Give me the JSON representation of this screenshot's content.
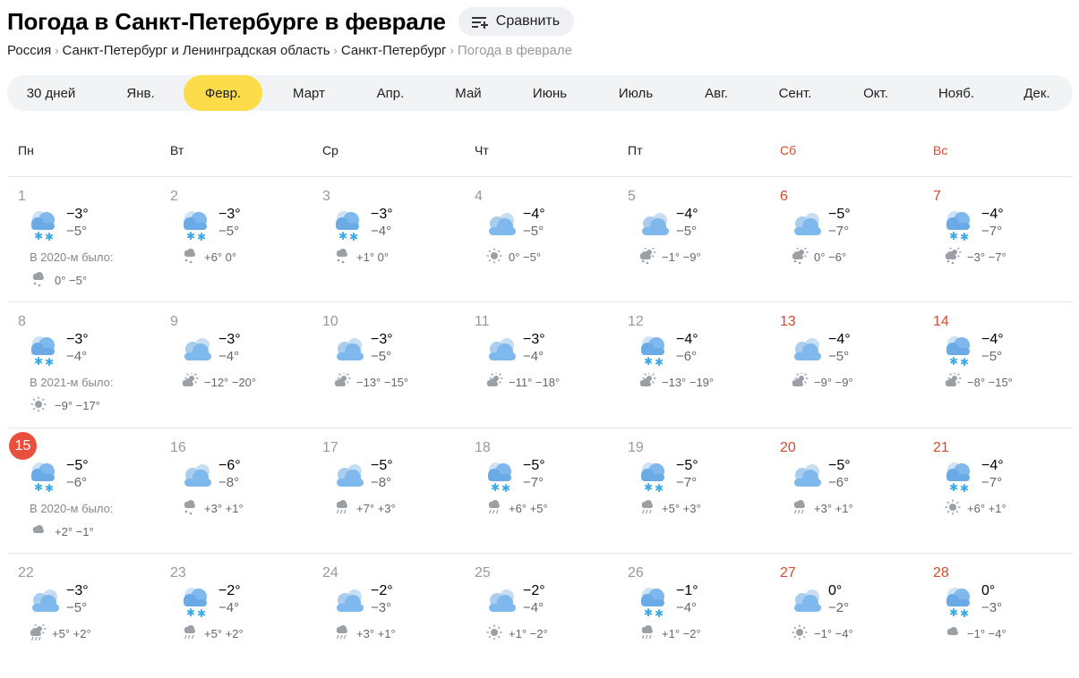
{
  "header": {
    "title": "Погода в Санкт-Петербурге в феврале",
    "compare_label": "Сравнить"
  },
  "breadcrumbs": [
    "Россия",
    "Санкт-Петербург и Ленинградская область",
    "Санкт-Петербург",
    "Погода в феврале"
  ],
  "months": [
    {
      "label": "30 дней",
      "active": false
    },
    {
      "label": "Янв.",
      "active": false
    },
    {
      "label": "Февр.",
      "active": true
    },
    {
      "label": "Март",
      "active": false
    },
    {
      "label": "Апр.",
      "active": false
    },
    {
      "label": "Май",
      "active": false
    },
    {
      "label": "Июнь",
      "active": false
    },
    {
      "label": "Июль",
      "active": false
    },
    {
      "label": "Авг.",
      "active": false
    },
    {
      "label": "Сент.",
      "active": false
    },
    {
      "label": "Окт.",
      "active": false
    },
    {
      "label": "Нояб.",
      "active": false
    },
    {
      "label": "Дек.",
      "active": false
    }
  ],
  "weekdays": [
    {
      "label": "Пн",
      "weekend": false
    },
    {
      "label": "Вт",
      "weekend": false
    },
    {
      "label": "Ср",
      "weekend": false
    },
    {
      "label": "Чт",
      "weekend": false
    },
    {
      "label": "Пт",
      "weekend": false
    },
    {
      "label": "Сб",
      "weekend": true
    },
    {
      "label": "Вс",
      "weekend": true
    }
  ],
  "colors": {
    "accent": "#fddc4a",
    "weekend": "#d84a2e",
    "today": "#e8503d"
  },
  "days": [
    {
      "day": "1",
      "max": "−3°",
      "min": "−5°",
      "icon": "cloud-snow-icon",
      "hist_label": "В 2020-м было:",
      "hist_icon": "cloud-snow-small-icon",
      "hist_temps": "0° −5°"
    },
    {
      "day": "2",
      "max": "−3°",
      "min": "−5°",
      "icon": "cloud-snow-icon",
      "norm_icon": "cloud-snow-small-icon",
      "norm": "+6° 0°"
    },
    {
      "day": "3",
      "max": "−3°",
      "min": "−4°",
      "icon": "cloud-snow-icon",
      "norm_icon": "cloud-snow-small-icon",
      "norm": "+1° 0°"
    },
    {
      "day": "4",
      "max": "−4°",
      "min": "−5°",
      "icon": "cloudy-icon",
      "norm_icon": "sun-small-icon",
      "norm": "0° −5°"
    },
    {
      "day": "5",
      "max": "−4°",
      "min": "−5°",
      "icon": "cloudy-icon",
      "norm_icon": "sun-cloud-snow-small-icon",
      "norm": "−1° −9°"
    },
    {
      "day": "6",
      "max": "−5°",
      "min": "−7°",
      "icon": "cloudy-icon",
      "norm_icon": "sun-cloud-snow-small-icon",
      "norm": "0° −6°"
    },
    {
      "day": "7",
      "max": "−4°",
      "min": "−7°",
      "icon": "cloud-snow-icon",
      "norm_icon": "sun-cloud-snow-small-icon",
      "norm": "−3° −7°"
    },
    {
      "day": "8",
      "max": "−3°",
      "min": "−4°",
      "icon": "cloud-snow-icon",
      "hist_label": "В 2021-м было:",
      "hist_icon": "sun-small-icon",
      "hist_temps": "−9° −17°"
    },
    {
      "day": "9",
      "max": "−3°",
      "min": "−4°",
      "icon": "cloudy-icon",
      "norm_icon": "sun-cloud-small-icon",
      "norm": "−12° −20°"
    },
    {
      "day": "10",
      "max": "−3°",
      "min": "−5°",
      "icon": "cloudy-icon",
      "norm_icon": "sun-cloud-small-icon",
      "norm": "−13° −15°"
    },
    {
      "day": "11",
      "max": "−3°",
      "min": "−4°",
      "icon": "cloudy-icon",
      "norm_icon": "sun-cloud-small-icon",
      "norm": "−11° −18°"
    },
    {
      "day": "12",
      "max": "−4°",
      "min": "−6°",
      "icon": "cloud-snow-icon",
      "norm_icon": "sun-cloud-small-icon",
      "norm": "−13° −19°"
    },
    {
      "day": "13",
      "max": "−4°",
      "min": "−5°",
      "icon": "cloudy-icon",
      "norm_icon": "sun-cloud-small-icon",
      "norm": "−9° −9°"
    },
    {
      "day": "14",
      "max": "−4°",
      "min": "−5°",
      "icon": "cloud-snow-icon",
      "norm_icon": "sun-cloud-small-icon",
      "norm": "−8° −15°"
    },
    {
      "day": "15",
      "today": true,
      "max": "−5°",
      "min": "−6°",
      "icon": "cloud-snow-icon",
      "hist_label": "В 2020-м было:",
      "hist_icon": "cloud-small-icon",
      "hist_temps": "+2° −1°"
    },
    {
      "day": "16",
      "max": "−6°",
      "min": "−8°",
      "icon": "cloudy-icon",
      "norm_icon": "cloud-snow-small-icon",
      "norm": "+3° +1°"
    },
    {
      "day": "17",
      "max": "−5°",
      "min": "−8°",
      "icon": "cloudy-icon",
      "norm_icon": "cloud-rain-small-icon",
      "norm": "+7° +3°"
    },
    {
      "day": "18",
      "max": "−5°",
      "min": "−7°",
      "icon": "cloud-snow-icon",
      "norm_icon": "cloud-rain-small-icon",
      "norm": "+6° +5°"
    },
    {
      "day": "19",
      "max": "−5°",
      "min": "−7°",
      "icon": "cloud-snow-icon",
      "norm_icon": "cloud-rain-small-icon",
      "norm": "+5° +3°"
    },
    {
      "day": "20",
      "max": "−5°",
      "min": "−6°",
      "icon": "cloudy-icon",
      "norm_icon": "cloud-rain-small-icon",
      "norm": "+3° +1°"
    },
    {
      "day": "21",
      "max": "−4°",
      "min": "−7°",
      "icon": "cloud-snow-icon",
      "norm_icon": "sun-small-icon",
      "norm": "+6° +1°"
    },
    {
      "day": "22",
      "max": "−3°",
      "min": "−5°",
      "icon": "cloudy-icon",
      "norm_icon": "sun-cloud-rain-small-icon",
      "norm": "+5° +2°"
    },
    {
      "day": "23",
      "max": "−2°",
      "min": "−4°",
      "icon": "cloud-snow-icon",
      "norm_icon": "cloud-rain-small-icon",
      "norm": "+5° +2°"
    },
    {
      "day": "24",
      "max": "−2°",
      "min": "−3°",
      "icon": "cloudy-icon",
      "norm_icon": "cloud-rain-small-icon",
      "norm": "+3° +1°"
    },
    {
      "day": "25",
      "max": "−2°",
      "min": "−4°",
      "icon": "cloudy-icon",
      "norm_icon": "sun-small-icon",
      "norm": "+1° −2°"
    },
    {
      "day": "26",
      "max": "−1°",
      "min": "−4°",
      "icon": "cloud-snow-icon",
      "norm_icon": "cloud-rain-small-icon",
      "norm": "+1° −2°"
    },
    {
      "day": "27",
      "max": "0°",
      "min": "−2°",
      "icon": "cloudy-icon",
      "norm_icon": "sun-small-icon",
      "norm": "−1° −4°"
    },
    {
      "day": "28",
      "max": "0°",
      "min": "−3°",
      "icon": "cloud-snow-icon",
      "norm_icon": "cloud-small-icon",
      "norm": "−1° −4°"
    }
  ]
}
